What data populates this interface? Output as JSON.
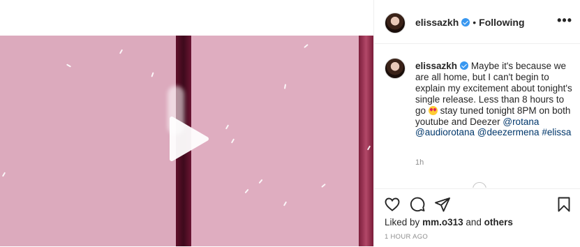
{
  "post": {
    "author": "elissazkh",
    "follow_separator": "•",
    "follow_state": "Following",
    "more_label": "•••",
    "caption_text_1": "Maybe it's because we are all home, but I can't begin to explain my excitement about tonight's single release. Less than 8 hours to go",
    "caption_text_2": "stay tuned tonight 8PM on both youtube and Deezer",
    "mentions": [
      "@rotana",
      "@audiorotana",
      "@deezermena"
    ],
    "hashtag": "#elissa",
    "caption_time": "1h",
    "likes_prefix": "Liked by",
    "liked_by_user": "mm.o313",
    "likes_and": "and",
    "likes_others": "others",
    "posted_ago": "1 HOUR AGO"
  },
  "icons": {
    "play": "play-icon",
    "verified": "verified-badge-icon",
    "like": "heart-icon",
    "comment": "comment-icon",
    "share": "share-icon",
    "save": "bookmark-icon",
    "emoji": "heart-eyes-emoji"
  },
  "colors": {
    "verified": "#3897f0",
    "link": "#00376b",
    "muted": "#8e8e8e",
    "video_bg": "#dba8bb"
  }
}
